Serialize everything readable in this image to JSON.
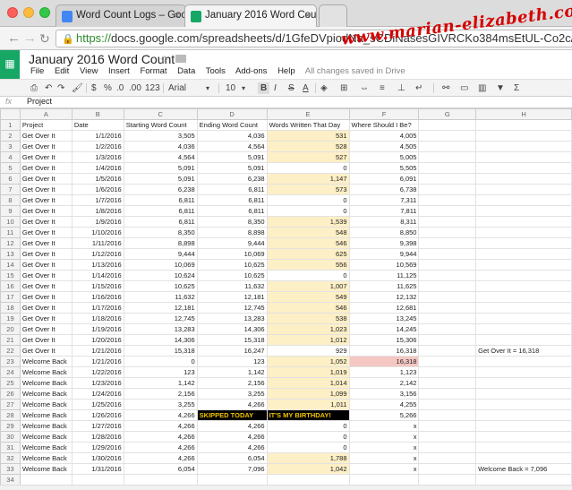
{
  "browser": {
    "tabs": [
      {
        "title": "Word Count Logs – Google",
        "active": false
      },
      {
        "title": "January 2016 Word Count",
        "active": true
      }
    ],
    "url_scheme": "https://",
    "url_rest": "docs.google.com/spreadsheets/d/1GfeDVpiodNa_sCDiNasesGIVRCKo384msEtUL-Co2c/edit#gid=0"
  },
  "watermark_text": "www.marian-elizabeth.com",
  "doc": {
    "title": "January 2016 Word Count *",
    "menu": [
      "File",
      "Edit",
      "View",
      "Insert",
      "Format",
      "Data",
      "Tools",
      "Add-ons",
      "Help"
    ],
    "saved_status": "All changes saved in Drive"
  },
  "toolbar": {
    "currency": "$",
    "percent": "%",
    "decimal_less": ".0",
    "decimal_more": ".00",
    "more_formats": "123",
    "font": "Arial",
    "font_size": "10",
    "bold": "B",
    "italic": "I",
    "strike": "S",
    "text_color": "A"
  },
  "formula_bar": {
    "label": "fx",
    "value": "Project"
  },
  "sheet": {
    "columns": [
      "A",
      "B",
      "C",
      "D",
      "E",
      "F",
      "G",
      "H"
    ],
    "headers": [
      "Project",
      "Date",
      "Starting Word Count",
      "Ending Word Count",
      "Words Written That Day",
      "Where Should I Be?",
      "",
      ""
    ],
    "rows": [
      [
        "Get Over It",
        "1/1/2016",
        "3,505",
        "4,036",
        "531",
        "4,005",
        "",
        ""
      ],
      [
        "Get Over It",
        "1/2/2016",
        "4,036",
        "4,564",
        "528",
        "4,505",
        "",
        ""
      ],
      [
        "Get Over It",
        "1/3/2016",
        "4,564",
        "5,091",
        "527",
        "5,005",
        "",
        ""
      ],
      [
        "Get Over It",
        "1/4/2016",
        "5,091",
        "5,091",
        "0",
        "5,505",
        "",
        ""
      ],
      [
        "Get Over It",
        "1/5/2016",
        "5,091",
        "6,238",
        "1,147",
        "6,091",
        "",
        ""
      ],
      [
        "Get Over It",
        "1/6/2016",
        "6,238",
        "6,811",
        "573",
        "6,738",
        "",
        ""
      ],
      [
        "Get Over It",
        "1/7/2016",
        "6,811",
        "6,811",
        "0",
        "7,311",
        "",
        ""
      ],
      [
        "Get Over It",
        "1/8/2016",
        "6,811",
        "6,811",
        "0",
        "7,811",
        "",
        ""
      ],
      [
        "Get Over It",
        "1/9/2016",
        "6,811",
        "8,350",
        "1,539",
        "8,311",
        "",
        ""
      ],
      [
        "Get Over It",
        "1/10/2016",
        "8,350",
        "8,898",
        "548",
        "8,850",
        "",
        ""
      ],
      [
        "Get Over It",
        "1/11/2016",
        "8,898",
        "9,444",
        "546",
        "9,398",
        "",
        ""
      ],
      [
        "Get Over It",
        "1/12/2016",
        "9,444",
        "10,069",
        "625",
        "9,944",
        "",
        ""
      ],
      [
        "Get Over It",
        "1/13/2016",
        "10,069",
        "10,625",
        "556",
        "10,569",
        "",
        ""
      ],
      [
        "Get Over It",
        "1/14/2016",
        "10,624",
        "10,625",
        "0",
        "11,125",
        "",
        ""
      ],
      [
        "Get Over It",
        "1/15/2016",
        "10,625",
        "11,632",
        "1,007",
        "11,625",
        "",
        ""
      ],
      [
        "Get Over It",
        "1/16/2016",
        "11,632",
        "12,181",
        "549",
        "12,132",
        "",
        ""
      ],
      [
        "Get Over It",
        "1/17/2016",
        "12,181",
        "12,745",
        "546",
        "12,681",
        "",
        ""
      ],
      [
        "Get Over It",
        "1/18/2016",
        "12,745",
        "13,283",
        "538",
        "13,245",
        "",
        ""
      ],
      [
        "Get Over It",
        "1/19/2016",
        "13,283",
        "14,306",
        "1,023",
        "14,245",
        "",
        ""
      ],
      [
        "Get Over It",
        "1/20/2016",
        "14,306",
        "15,318",
        "1,012",
        "15,306",
        "",
        ""
      ],
      [
        "Get Over It",
        "1/21/2016",
        "15,318",
        "16,247",
        "929",
        "16,318",
        "",
        "Get Over It = 16,318"
      ],
      [
        "Welcome Back",
        "1/21/2016",
        "0",
        "123",
        "1,052",
        "16,318",
        "",
        ""
      ],
      [
        "Welcome Back",
        "1/22/2016",
        "123",
        "1,142",
        "1,019",
        "1,123",
        "",
        ""
      ],
      [
        "Welcome Back",
        "1/23/2016",
        "1,142",
        "2,156",
        "1,014",
        "2,142",
        "",
        ""
      ],
      [
        "Welcome Back",
        "1/24/2016",
        "2,156",
        "3,255",
        "1,099",
        "3,156",
        "",
        ""
      ],
      [
        "Welcome Back",
        "1/25/2016",
        "3,255",
        "4,266",
        "1,011",
        "4,255",
        "",
        ""
      ],
      [
        "Welcome Back",
        "1/26/2016",
        "4,266",
        "SKIPPED TODAY",
        "IT'S MY BIRTHDAY!",
        "5,266",
        "",
        ""
      ],
      [
        "Welcome Back",
        "1/27/2016",
        "4,266",
        "4,266",
        "0",
        "x",
        "",
        ""
      ],
      [
        "Welcome Back",
        "1/28/2016",
        "4,266",
        "4,266",
        "0",
        "x",
        "",
        ""
      ],
      [
        "Welcome Back",
        "1/29/2016",
        "4,266",
        "4,266",
        "0",
        "x",
        "",
        ""
      ],
      [
        "Welcome Back",
        "1/30/2016",
        "4,266",
        "6,054",
        "1,788",
        "x",
        "",
        ""
      ],
      [
        "Welcome Back",
        "1/31/2016",
        "6,054",
        "7,096",
        "1,042",
        "x",
        "",
        "Welcome Back = 7,096"
      ],
      [
        "",
        "",
        "",
        "",
        "",
        "",
        "",
        ""
      ]
    ],
    "highlight_rows": [
      0,
      1,
      2,
      4,
      5,
      8,
      9,
      10,
      11,
      12,
      14,
      15,
      16,
      17,
      18,
      19,
      21,
      22,
      23,
      24,
      25,
      30,
      31
    ],
    "pink_cell_row": 21,
    "banner_row": 26
  }
}
